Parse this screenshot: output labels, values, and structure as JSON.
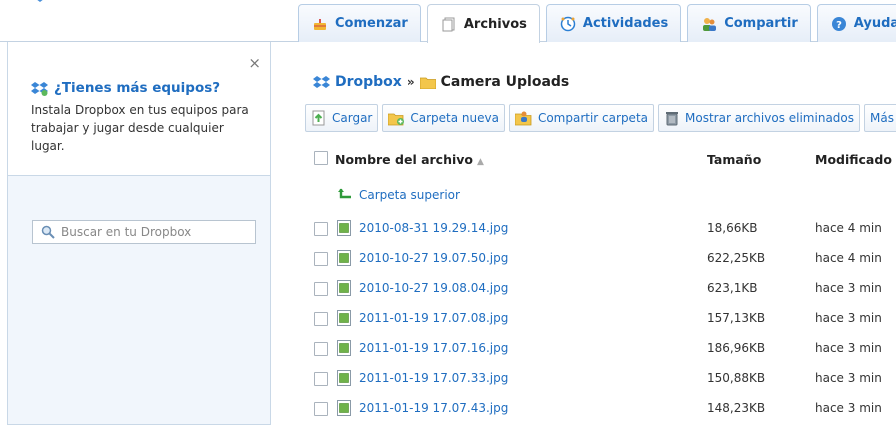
{
  "tabs": [
    {
      "label": "Comenzar",
      "icon": "cake-icon"
    },
    {
      "label": "Archivos",
      "icon": "files-icon",
      "active": true
    },
    {
      "label": "Actividades",
      "icon": "clock-icon"
    },
    {
      "label": "Compartir",
      "icon": "people-icon"
    },
    {
      "label": "Ayuda",
      "icon": "help-icon"
    }
  ],
  "sidebar": {
    "promo_title": "¿Tienes más equipos?",
    "promo_text": "Instala Dropbox en tus equipos para trabajar y jugar desde cualquier lugar.",
    "close": "×",
    "search_placeholder": "Buscar en tu Dropbox"
  },
  "breadcrumb": {
    "root": "Dropbox",
    "separator": "»",
    "current": "Camera Uploads"
  },
  "toolbar": {
    "upload": "Cargar",
    "new_folder": "Carpeta nueva",
    "share_folder": "Compartir carpeta",
    "show_deleted": "Mostrar archivos eliminados",
    "more": "Más"
  },
  "table": {
    "col_name": "Nombre del archivo",
    "col_size": "Tamaño",
    "col_modified": "Modificado",
    "parent_folder": "Carpeta superior",
    "rows": [
      {
        "name": "2010-08-31 19.29.14.jpg",
        "size": "18,66KB",
        "modified": "hace 4 min"
      },
      {
        "name": "2010-10-27 19.07.50.jpg",
        "size": "622,25KB",
        "modified": "hace 4 min"
      },
      {
        "name": "2010-10-27 19.08.04.jpg",
        "size": "623,1KB",
        "modified": "hace 3 min"
      },
      {
        "name": "2011-01-19 17.07.08.jpg",
        "size": "157,13KB",
        "modified": "hace 3 min"
      },
      {
        "name": "2011-01-19 17.07.16.jpg",
        "size": "186,96KB",
        "modified": "hace 3 min"
      },
      {
        "name": "2011-01-19 17.07.33.jpg",
        "size": "150,88KB",
        "modified": "hace 3 min"
      },
      {
        "name": "2011-01-19 17.07.43.jpg",
        "size": "148,23KB",
        "modified": "hace 3 min"
      }
    ]
  },
  "colors": {
    "link": "#1f6dc0",
    "border": "#c3d2e2",
    "sidebar_bg": "#f1f6fc"
  }
}
